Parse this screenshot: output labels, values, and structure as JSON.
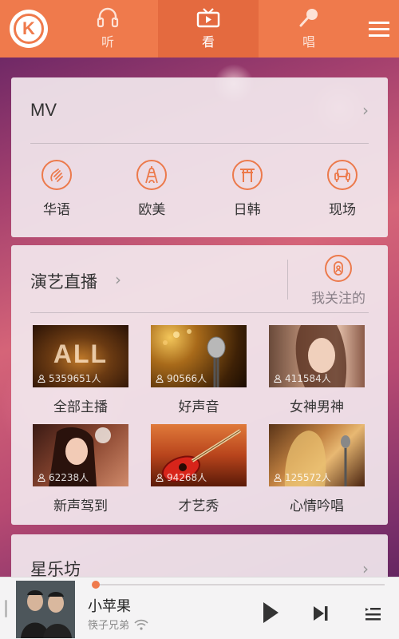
{
  "topbar": {
    "logo_letter": "K",
    "tabs": [
      {
        "label": "听",
        "icon": "headphones-icon"
      },
      {
        "label": "看",
        "icon": "tv-icon",
        "active": true
      },
      {
        "label": "唱",
        "icon": "microphone-icon"
      }
    ],
    "menu_icon": "menu-icon"
  },
  "mv": {
    "title": "MV",
    "categories": [
      {
        "label": "华语",
        "icon": "chinese-hand-icon"
      },
      {
        "label": "欧美",
        "icon": "eiffel-tower-icon"
      },
      {
        "label": "日韩",
        "icon": "torii-gate-icon"
      },
      {
        "label": "现场",
        "icon": "sofa-icon"
      }
    ]
  },
  "live": {
    "title": "演艺直播",
    "follow_label": "我关注的",
    "tiles": [
      {
        "label": "全部主播",
        "count": "5359651人",
        "overlay": "ALL"
      },
      {
        "label": "好声音",
        "count": "90566人"
      },
      {
        "label": "女神男神",
        "count": "411584人"
      },
      {
        "label": "新声驾到",
        "count": "62238人"
      },
      {
        "label": "才艺秀",
        "count": "94268人"
      },
      {
        "label": "心情吟唱",
        "count": "125572人"
      }
    ]
  },
  "star": {
    "title": "星乐坊"
  },
  "player": {
    "song": "小苹果",
    "artist": "筷子兄弟",
    "progress": 0.01
  },
  "colors": {
    "accent": "#ef7a4c",
    "topbar": "#ef7a4c"
  }
}
